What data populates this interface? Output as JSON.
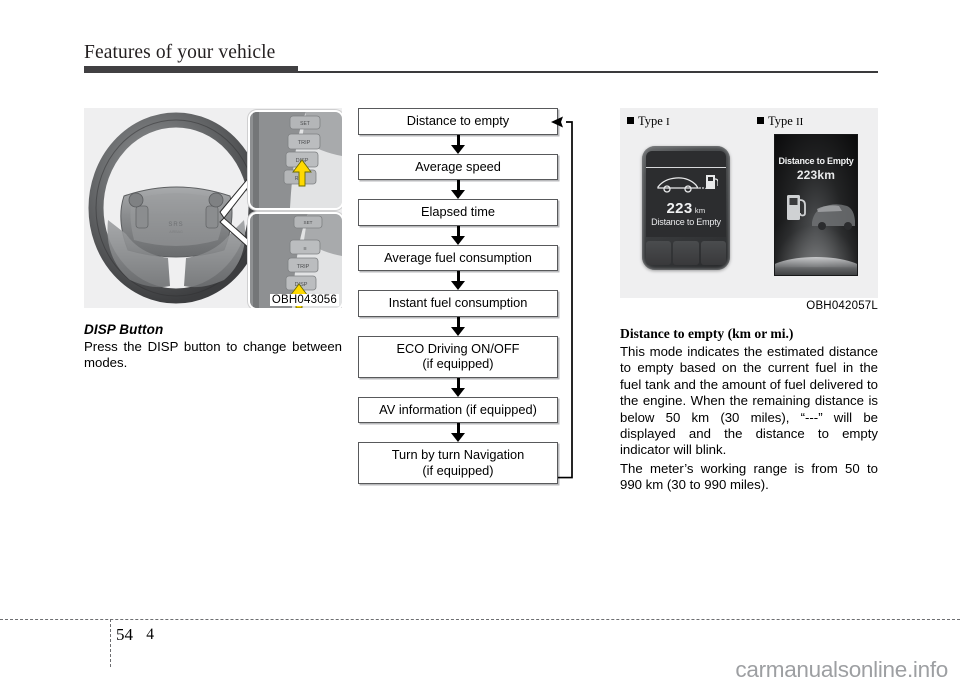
{
  "header": {
    "title": "Features of your vehicle"
  },
  "left": {
    "figure_caption": "OBH043056",
    "figure_alt": "steering-wheel-with-disp-button",
    "inset_buttons_top": [
      "TRIP",
      "DISP",
      "RES"
    ],
    "inset_buttons_bottom": [
      "SET",
      "TRIP",
      "DISP"
    ],
    "heading": "DISP Button",
    "paragraph": "Press the DISP button to change between modes."
  },
  "flowchart": {
    "steps": [
      {
        "line1": "Distance to empty",
        "line2": ""
      },
      {
        "line1": "Average speed",
        "line2": ""
      },
      {
        "line1": "Elapsed time",
        "line2": ""
      },
      {
        "line1": "Average fuel consumption",
        "line2": ""
      },
      {
        "line1": "Instant fuel consumption",
        "line2": ""
      },
      {
        "line1": "ECO Driving ON/OFF",
        "line2": "(if equipped)"
      },
      {
        "line1": "AV information (if equipped)",
        "line2": ""
      },
      {
        "line1": "Turn by turn Navigation",
        "line2": "(if equipped)"
      }
    ]
  },
  "right": {
    "type1_label": "Type",
    "type1_numeral": "I",
    "type2_label": "Type",
    "type2_numeral": "II",
    "cluster_type1": {
      "value": "223",
      "unit": "km",
      "caption": "Distance to Empty"
    },
    "cluster_type2": {
      "title": "Distance to Empty",
      "value": "223km"
    },
    "figure_caption": "OBH042057L",
    "heading": "Distance to empty (km or mi.)",
    "paragraph1": "This mode indicates the estimated distance to empty based on the current fuel in the fuel tank and the amount of fuel delivered to the engine. When the remaining distance is below 50 km (30 miles), “---” will be displayed and the distance to empty indicator will blink.",
    "paragraph2": "The meter’s working range is from 50 to 990 km (30 to 990 miles)."
  },
  "footer": {
    "chapter": "4",
    "page": "54",
    "watermark": "carmanualsonline.info"
  }
}
